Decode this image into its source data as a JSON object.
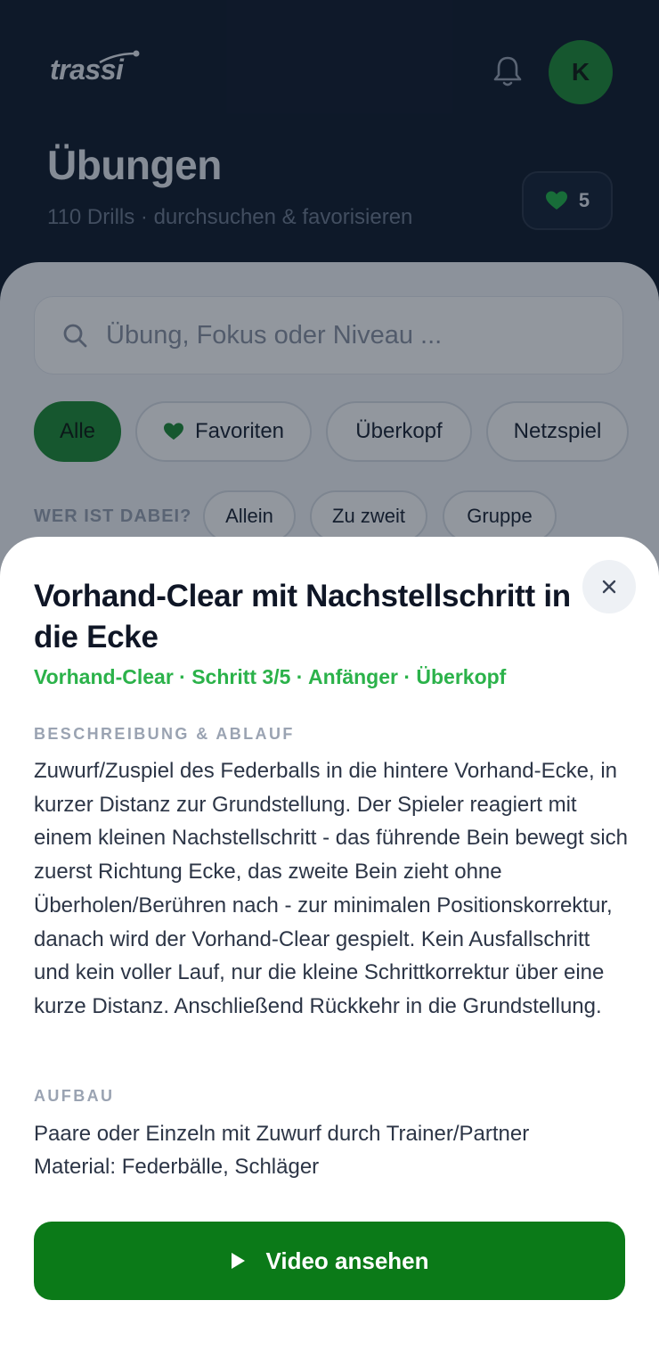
{
  "header": {
    "logo": "trassi",
    "avatar_initial": "K",
    "title": "Übungen",
    "subtitle": "110 Drills · durchsuchen & favorisieren",
    "favorites_count": "5"
  },
  "search": {
    "placeholder": "Übung, Fokus oder Niveau ..."
  },
  "filters": {
    "categories": [
      "Alle",
      "Favoriten",
      "Überkopf",
      "Netzspiel"
    ],
    "who_label": "WER IST DABEI?",
    "who_options": [
      "Allein",
      "Zu zweit",
      "Gruppe"
    ]
  },
  "sheet": {
    "title": "Vorhand-Clear mit Nachstellschritt in die Ecke",
    "meta": "Vorhand-Clear · Schritt 3/5 · Anfänger · Überkopf",
    "description_label": "BESCHREIBUNG & ABLAUF",
    "description": "Zuwurf/Zuspiel des Federballs in die hintere Vorhand-Ecke, in kurzer Distanz zur Grundstellung. Der Spieler reagiert mit einem kleinen Nachstellschritt - das führende Bein bewegt sich zuerst Richtung Ecke, das zweite Bein zieht ohne Überholen/Berühren nach - zur minimalen Positionskorrektur, danach wird der Vorhand-Clear gespielt. Kein Ausfallschritt und kein voller Lauf, nur die kleine Schrittkorrektur über eine kurze Distanz. Anschließend Rückkehr in die Grundstellung.",
    "setup_label": "AUFBAU",
    "setup_line1": "Paare oder Einzeln mit Zuwurf durch Trainer/Partner",
    "setup_line2": "Material: Federbälle, Schläger",
    "video_button": "Video ansehen"
  },
  "colors": {
    "brand_green": "#1e8a35",
    "accent_green_text": "#2bb24a",
    "button_green": "#0b7a18",
    "header_bg": "#0f1a2b"
  },
  "icons": [
    "bell-icon",
    "heart-icon",
    "search-icon",
    "close-icon",
    "play-icon"
  ]
}
